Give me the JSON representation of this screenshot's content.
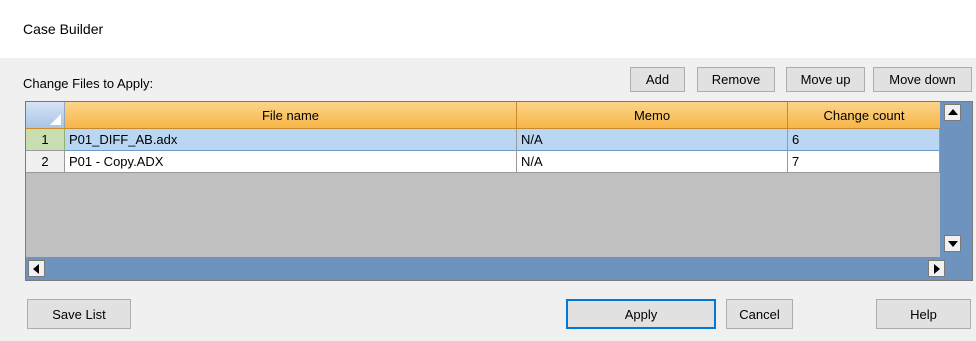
{
  "window": {
    "title": "Case Builder"
  },
  "files_section": {
    "label": "Change Files to Apply:",
    "buttons": {
      "add": "Add",
      "remove": "Remove",
      "move_up": "Move up",
      "move_down": "Move down"
    }
  },
  "grid": {
    "columns": [
      "File name",
      "Memo",
      "Change count"
    ],
    "rows": [
      {
        "num": "1",
        "file_name": "P01_DIFF_AB.adx",
        "memo": "N/A",
        "change_count": "6",
        "selected": true
      },
      {
        "num": "2",
        "file_name": "P01 - Copy.ADX",
        "memo": "N/A",
        "change_count": "7",
        "selected": false
      }
    ]
  },
  "footer": {
    "save_list": "Save List",
    "apply": "Apply",
    "cancel": "Cancel",
    "help": "Help"
  },
  "colors": {
    "header_orange": "#f7b648",
    "selected_row": "#b9d7f2",
    "grid_empty": "#c0c0c0",
    "scrollbar_track": "#6e93be"
  },
  "icons": [
    "scroll-up-icon",
    "scroll-down-icon",
    "scroll-left-icon",
    "scroll-right-icon",
    "corner-select-all-icon"
  ]
}
